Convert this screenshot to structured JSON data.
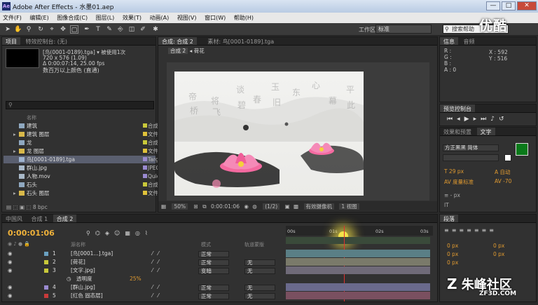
{
  "window": {
    "title": "Adobe After Effects - 水墨01.aep",
    "logo_text": "Ae",
    "minimize": "—",
    "maximize": "□",
    "close": "✕"
  },
  "menu": [
    "文件(F)",
    "编辑(E)",
    "图像合成(C)",
    "图层(L)",
    "效果(T)",
    "动画(A)",
    "视图(V)",
    "窗口(W)",
    "帮助(H)"
  ],
  "watermarks": {
    "youku": "优酷",
    "zhufeng": "朱峰社区",
    "zhufeng_url": "ZF3D.COM"
  },
  "toolbar": {
    "workspace_label": "工作区:",
    "workspace_value": "标准",
    "search_placeholder": "搜索帮助"
  },
  "project": {
    "tabs": [
      "项目",
      "特效控制台: (无)"
    ],
    "info": [
      "[鸟(0001-0189).tga] ▾ 被使用1次",
      "720 x 576 (1.09)",
      "Δ 0:00:07:14, 25.00 fps",
      "数百万以上颜色 (直通)"
    ],
    "header_name": "名称",
    "items": [
      {
        "name": "建筑",
        "type": "合成",
        "icon": "comp",
        "label": "#c8c83a",
        "sel": false,
        "tri": ""
      },
      {
        "name": "建筑 图层",
        "type": "文件夹",
        "icon": "folder",
        "label": "#e0c23a",
        "sel": false,
        "tri": "▸"
      },
      {
        "name": "龙",
        "type": "合成",
        "icon": "comp",
        "label": "#c8c83a",
        "sel": false,
        "tri": ""
      },
      {
        "name": "龙 图层",
        "type": "文件夹",
        "icon": "folder",
        "label": "#e0c23a",
        "sel": false,
        "tri": "▸"
      },
      {
        "name": "鸟[0001-0189].tga",
        "type": "Targa 序",
        "icon": "footage",
        "label": "#9a8ad0",
        "sel": true,
        "tri": ""
      },
      {
        "name": "群山.jpg",
        "type": "JPEG",
        "icon": "image",
        "label": "#9a8ad0",
        "sel": false,
        "tri": ""
      },
      {
        "name": "人物.mov",
        "type": "QuickTi...",
        "icon": "movie",
        "label": "#9a8ad0",
        "sel": false,
        "tri": ""
      },
      {
        "name": "石头",
        "type": "合成",
        "icon": "comp",
        "label": "#c8c83a",
        "sel": false,
        "tri": ""
      },
      {
        "name": "石头 图层",
        "type": "文件夹",
        "icon": "folder",
        "label": "#e0c23a",
        "sel": false,
        "tri": "▸"
      }
    ],
    "bpc": "8 bpc"
  },
  "comp": {
    "tabs": [
      "合成: 合成 2",
      "素材: 鸟[0001-0189].tga"
    ],
    "breadcrumb": [
      "合成 2",
      "荷花"
    ],
    "footer": {
      "zoom": "50%",
      "time": "0:00:01:06",
      "resolution": "(1/2)",
      "camera": "有效摄像机",
      "views": "1 视图"
    }
  },
  "info_panel": {
    "tabs": [
      "信息",
      "音频"
    ],
    "rgb": [
      "R :",
      "G :",
      "B :",
      "A : 0"
    ],
    "coords": [
      "X : 592",
      "Y : 516"
    ]
  },
  "preview_panel": {
    "tabs": [
      "预览控制台"
    ]
  },
  "char_panel": {
    "tabs": [
      "效果和预置",
      "文字"
    ],
    "font": "方正黑黑 简体",
    "size": "29 px",
    "leading": "自动",
    "kerning": "度量标准",
    "tracking": "-70",
    "unit": "px",
    "fill_color": "#0a7a1a"
  },
  "timeline": {
    "tabs": [
      "中国风",
      "合成 1",
      "合成 2"
    ],
    "timecode": "0:00:01:06",
    "ruler": [
      "00s",
      "01s",
      "02s",
      "03s"
    ],
    "layer_header": {
      "name": "源名称",
      "mode": "模式",
      "parent": "轨道蒙版"
    },
    "layers": [
      {
        "num": "1",
        "name": "[鸟[0001...].tga]",
        "mode": "正常",
        "parent": "",
        "color": "#6aa0c0",
        "bar": "#5a7f86"
      },
      {
        "num": "2",
        "name": "[荷花]",
        "mode": "正常",
        "parent": "无",
        "color": "#c8c83a",
        "bar": "#7a7a6a"
      },
      {
        "num": "3",
        "name": "[文字.jpg]",
        "mode": "变暗",
        "parent": "无",
        "color": "#c8c83a",
        "bar": "#6f6a78"
      },
      {
        "num": "",
        "name": "透明度",
        "mode": "",
        "parent": "",
        "color": "",
        "bar": "",
        "value": "25%"
      },
      {
        "num": "4",
        "name": "[群山.jpg]",
        "mode": "正常",
        "parent": "无",
        "color": "#9a8ad0",
        "bar": "#6a6a8c"
      },
      {
        "num": "5",
        "name": "[红色 固态层]",
        "mode": "正常",
        "parent": "无",
        "color": "#c83a3a",
        "bar": "#7a5060"
      }
    ]
  },
  "para_panel": {
    "tabs": [
      "段落"
    ],
    "values": [
      "0 px",
      "0 px",
      "0 px",
      "0 px",
      "0 px"
    ]
  }
}
